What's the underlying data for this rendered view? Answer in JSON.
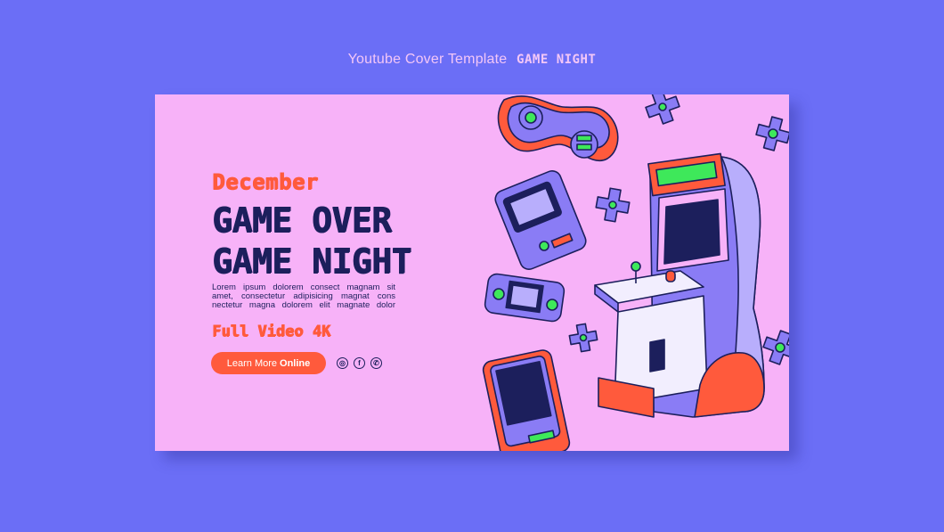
{
  "header": {
    "title": "Youtube Cover Template",
    "brand": "GAME NIGHT"
  },
  "card": {
    "month": "December",
    "headline_line1": "GAME OVER",
    "headline_line2": "GAME NIGHT",
    "body_line1": "Lorem ipsum dolorem consect magnam sit",
    "body_line2": "amet, consectetur adipisicing magnat cons",
    "body_line3": "nectetur magna dolorem elit magnate dolor",
    "subline": "Full Video 4K",
    "cta_prefix": "Learn More",
    "cta_bold": "Online",
    "socials": [
      {
        "icon": "instagram-icon",
        "glyph": "◎"
      },
      {
        "icon": "facebook-icon",
        "glyph": "f"
      },
      {
        "icon": "whatsapp-icon",
        "glyph": "✆"
      }
    ]
  },
  "colors": {
    "background": "#6b6ef6",
    "card": "#f7b2f8",
    "accent": "#ff5a3c",
    "ink": "#1c1f5c",
    "green": "#3ee85a",
    "purple": "#8a7cf5"
  },
  "illustrations": [
    "gamepad-icon",
    "handheld-console-icon",
    "portable-console-icon",
    "phone-icon",
    "arcade-cabinet-icon",
    "dpad-icon"
  ]
}
